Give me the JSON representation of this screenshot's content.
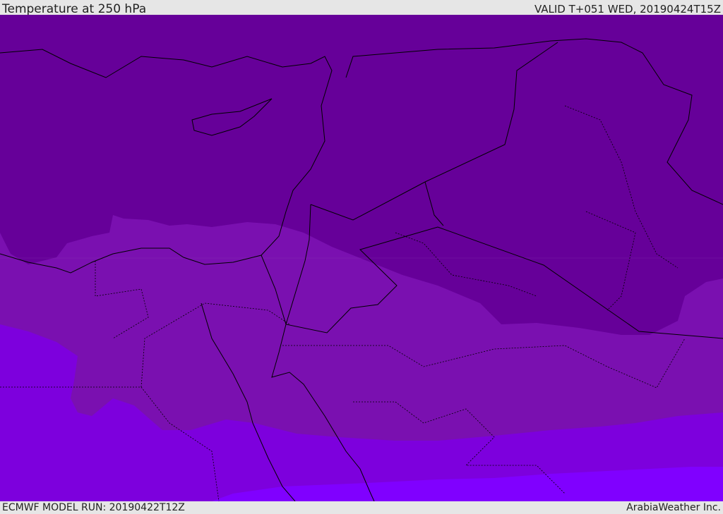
{
  "header": {
    "title": "Temperature at 250 hPa",
    "valid": "VALID T+051 WED, 20190424T15Z"
  },
  "footer": {
    "model_run": "ECMWF MODEL RUN: 20190422T12Z",
    "credit": "ArabiaWeather Inc."
  },
  "colors": {
    "band_coldest": "#660099",
    "band_cold": "#7a10b0",
    "band_mid": "#7d00dd",
    "band_warm": "#8000ff",
    "lines": "#000000"
  }
}
